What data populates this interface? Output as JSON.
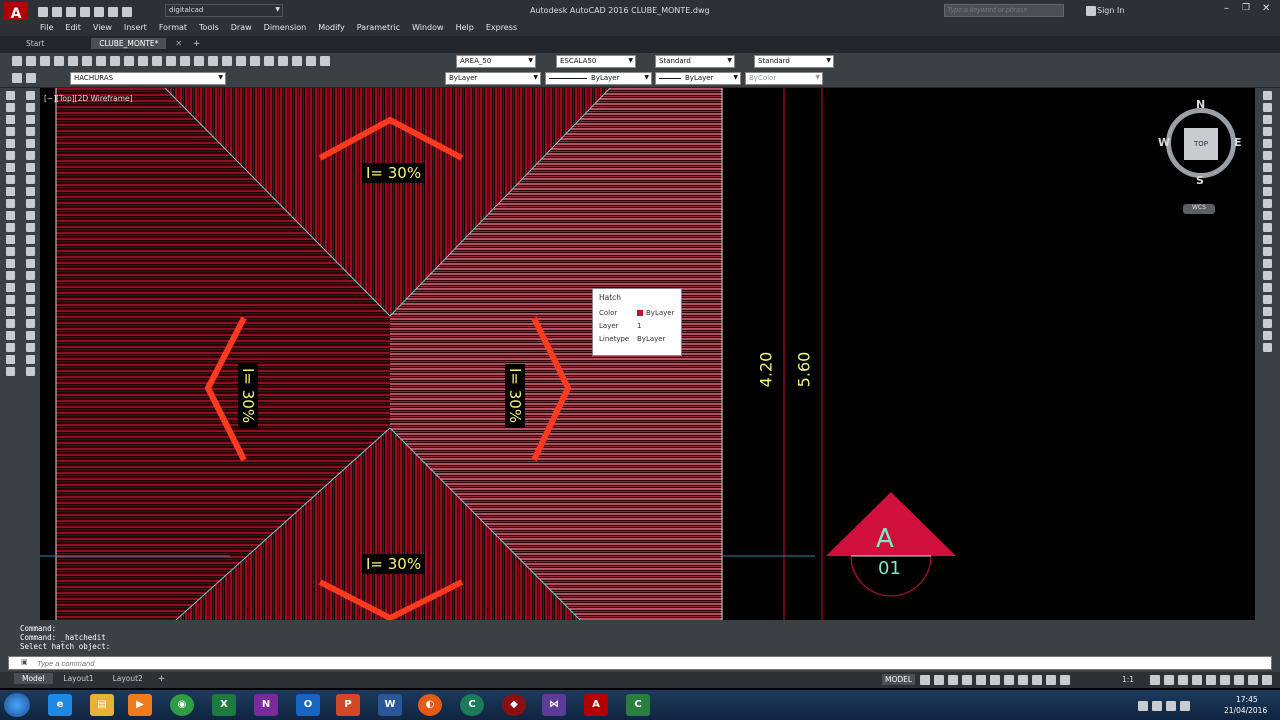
{
  "app": {
    "title": "Autodesk AutoCAD 2016    CLUBE_MONTE.dwg",
    "logo_letter": "A",
    "workspace": "digitalcad",
    "search_placeholder": "Type a keyword or phrase",
    "sign_in": "Sign In"
  },
  "menu": [
    "File",
    "Edit",
    "View",
    "Insert",
    "Format",
    "Tools",
    "Draw",
    "Dimension",
    "Modify",
    "Parametric",
    "Window",
    "Help",
    "Express"
  ],
  "doc_tabs": [
    {
      "label": "Start",
      "active": false
    },
    {
      "label": "CLUBE_MONTE*",
      "active": true
    }
  ],
  "toolbar1": {
    "text_style": "ÁREA_50",
    "dim_style": "ESCALA50",
    "table_style": "Standard",
    "mleader_style": "Standard"
  },
  "toolbar2": {
    "layer": "HACHURAS",
    "color": "ByLayer",
    "linetype": "ByLayer",
    "lineweight": "ByLayer",
    "plotstyle": "ByColor"
  },
  "viewport": {
    "label": "[−][Top][2D Wireframe]",
    "slope_label": "I= 30%",
    "dim_1": "4.20",
    "dim_2": "5.60",
    "section_letter": "A",
    "section_number": "01",
    "hatch_red": "#c8102e",
    "hatch_pink": "#e0607a",
    "slope_color": "#ff3b1f",
    "text_yellow": "#f5f57a"
  },
  "viewcube": {
    "north": "N",
    "south": "S",
    "east": "E",
    "west": "W",
    "face": "TOP",
    "ucs": "WCS"
  },
  "tooltip": {
    "title": "Hatch",
    "rows": [
      {
        "key": "Color",
        "value": "ByLayer"
      },
      {
        "key": "Layer",
        "value": "1"
      },
      {
        "key": "Linetype",
        "value": "ByLayer"
      }
    ]
  },
  "command": {
    "history": [
      "Command:",
      "Command: _hatchedit",
      "Select hatch object:"
    ],
    "placeholder": "Type a command"
  },
  "layout_tabs": [
    "Model",
    "Layout1",
    "Layout2"
  ],
  "status": {
    "mode": "MODEL",
    "scale": "1:1"
  },
  "clock": {
    "time": "17:45",
    "date": "21/04/2016"
  }
}
